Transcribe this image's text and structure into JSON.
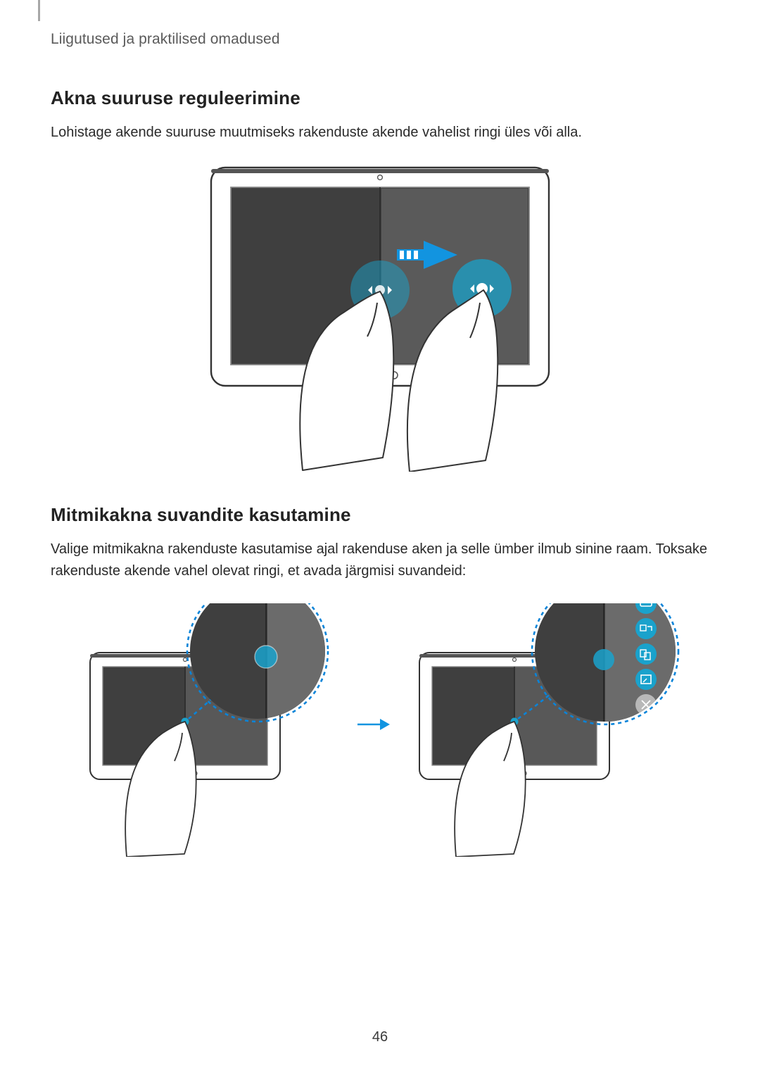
{
  "runningHead": "Liigutused ja praktilised omadused",
  "section1": {
    "heading": "Akna suuruse reguleerimine",
    "body": "Lohistage akende suuruse muutmiseks rakenduste akende vahelist ringi üles või alla."
  },
  "section2": {
    "heading": "Mitmikakna suvandite kasutamine",
    "body": "Valige mitmikakna rakenduste kasutamise ajal rakenduse aken ja selle ümber ilmub sinine raam. Toksake rakenduste akende vahel olevat ringi, et avada järgmisi suvandeid:"
  },
  "pageNumber": "46"
}
